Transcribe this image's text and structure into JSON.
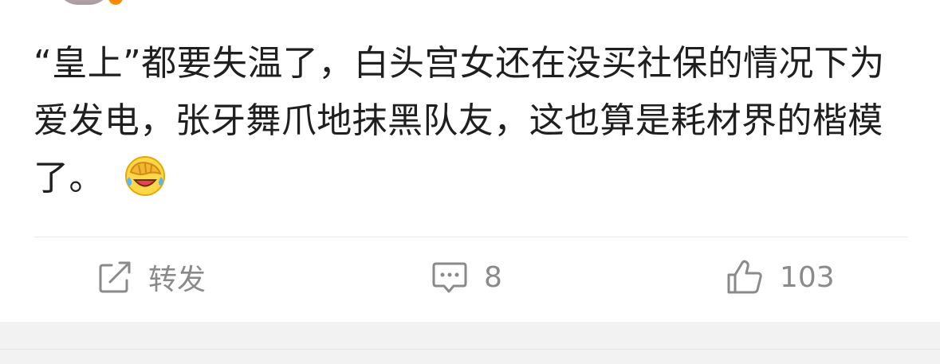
{
  "post": {
    "text": "“皇上”都要失温了，白头宫女还在没买社保的情况下为爱发电，张牙舞爪地抹黑队友，这也算是耗材界的楷模了。",
    "emoji": "face-palm-laughing-emoji"
  },
  "actions": {
    "repost_label": "转发",
    "comment_count": "8",
    "like_count": "103"
  },
  "colors": {
    "text": "#1f1f1f",
    "action": "#8a8a8a",
    "footer": "#f2f2f2"
  }
}
